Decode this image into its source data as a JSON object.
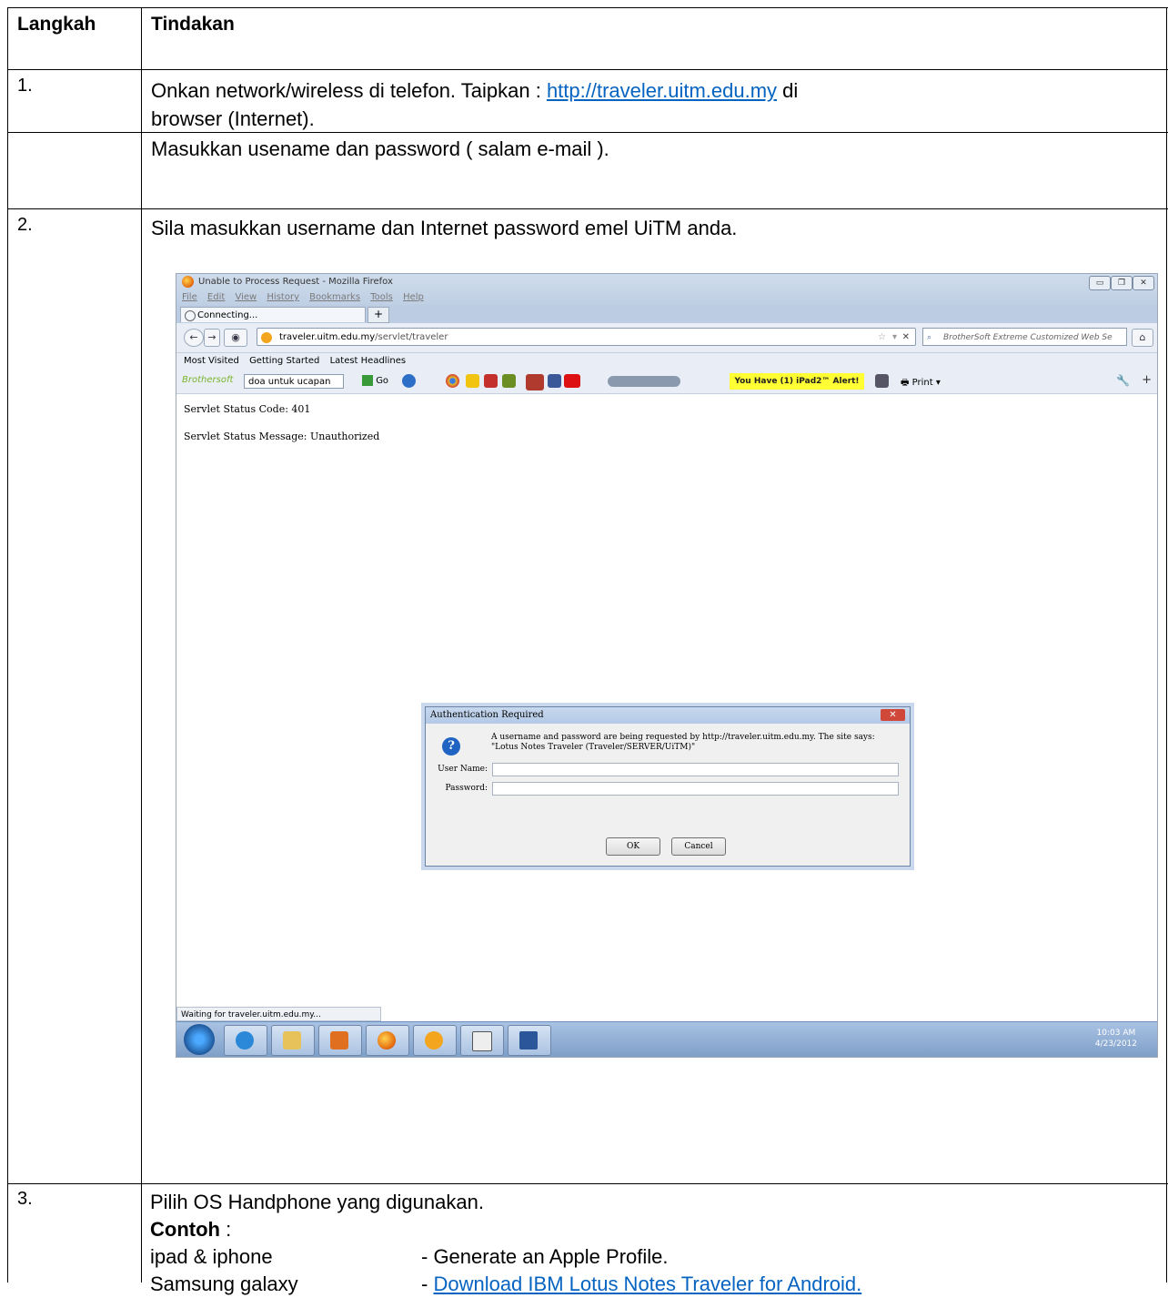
{
  "header": {
    "col1": "Langkah",
    "col2": "Tindakan"
  },
  "rows": [
    {
      "num": "1.",
      "line1_pre": "Onkan network/wireless di telefon. Taipkan : ",
      "line1_link": "http://traveler.uitm.edu.my",
      "line1_post": " di",
      "line2": "browser (Internet).",
      "line3": "Masukkan usename  dan password ( salam e-mail )."
    },
    {
      "num": "2.",
      "text": "Sila masukkan username dan Internet password emel UiTM anda."
    },
    {
      "num": "3.",
      "line1": "Pilih OS Handphone yang digunakan.",
      "contoh_label": "Contoh",
      "contoh_colon": " :",
      "examples": [
        {
          "device": "ipad & iphone",
          "action": "- Generate an Apple Profile.",
          "is_link": false
        },
        {
          "device": "Samsung galaxy",
          "action_dash": "- ",
          "action": "Download IBM Lotus Notes Traveler for Android.",
          "is_link": true
        }
      ]
    }
  ],
  "screenshot": {
    "window_title": "Unable to Process Request - Mozilla Firefox",
    "menu": [
      "File",
      "Edit",
      "View",
      "History",
      "Bookmarks",
      "Tools",
      "Help"
    ],
    "tab_label": "Connecting...",
    "url_host": "traveler.uitm.edu.my",
    "url_path": "/servlet/traveler",
    "search_placeholder": "BrotherSoft Extreme Customized Web Se",
    "bookmarks": [
      "Most Visited",
      "Getting Started",
      "Latest Headlines"
    ],
    "toolbar_brand": "Brothersoft",
    "toolbar_query": "doa untuk ucapan",
    "toolbar_go": "Go",
    "toolbar_alert": "You Have (1) iPad2™ Alert!",
    "toolbar_print": "Print",
    "status_code": "Servlet Status Code: 401",
    "status_message": "Servlet Status Message: Unauthorized",
    "status_bar": "Waiting for traveler.uitm.edu.my...",
    "clock_time": "10:03 AM",
    "clock_date": "4/23/2012",
    "dialog": {
      "title": "Authentication Required",
      "message": "A username and password are being requested by http://traveler.uitm.edu.my. The site says: \"Lotus Notes Traveler (Traveler/SERVER/UiTM)\"",
      "user_label": "User Name:",
      "pass_label": "Password:",
      "ok": "OK",
      "cancel": "Cancel"
    }
  }
}
